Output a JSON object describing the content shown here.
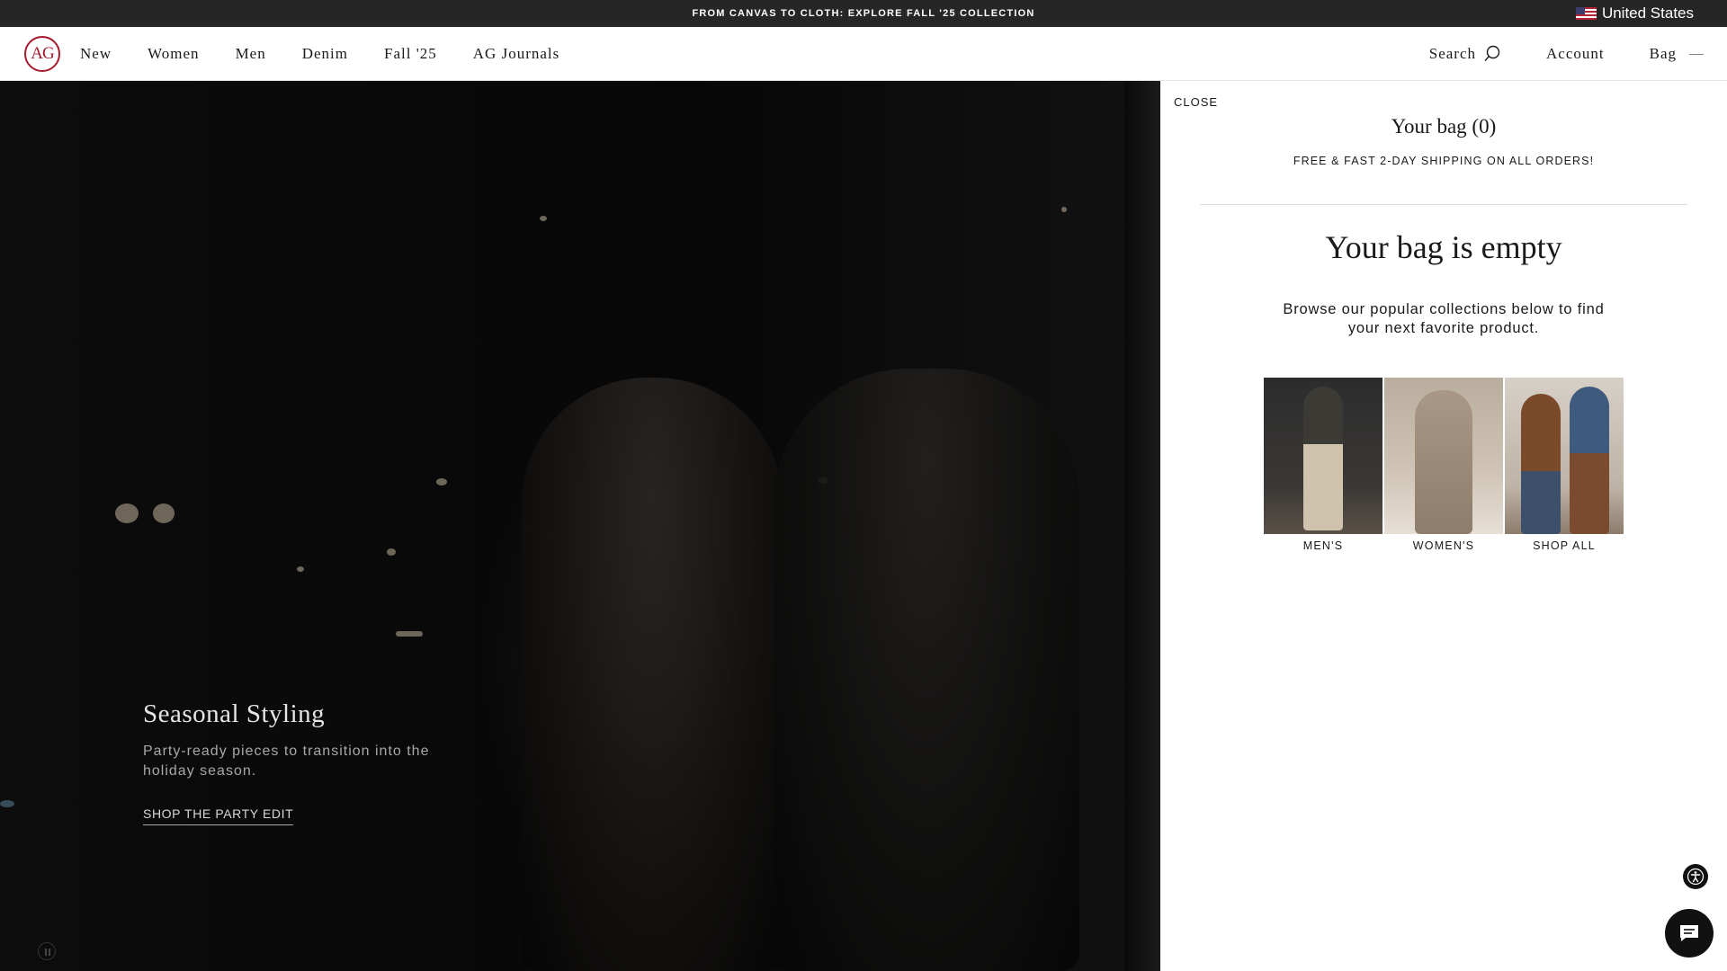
{
  "announcement": {
    "text": "FROM CANVAS TO CLOTH: EXPLORE FALL '25 COLLECTION",
    "region": "United States",
    "flag_icon": "us-flag-icon"
  },
  "header": {
    "logo_text": "AG",
    "brand_color": "#a6192e",
    "nav": [
      "New",
      "Women",
      "Men",
      "Denim",
      "Fall '25",
      "AG Journals"
    ],
    "search_label": "Search",
    "account_label": "Account",
    "bag_label": "Bag"
  },
  "hero": {
    "title": "Seasonal Styling",
    "subtitle": "Party-ready pieces to transition into the holiday season.",
    "cta": "SHOP THE PARTY EDIT"
  },
  "bag": {
    "close_label": "CLOSE",
    "title": "Your bag (0)",
    "shipping": "FREE & FAST 2-DAY SHIPPING ON ALL ORDERS!",
    "empty_title": "Your bag is empty",
    "empty_message": "Browse our popular collections below to find your next favorite product.",
    "collections": [
      "MEN'S",
      "WOMEN'S",
      "SHOP ALL"
    ]
  },
  "icons": {
    "search": "search-icon",
    "accessibility": "accessibility-icon",
    "chat": "chat-icon",
    "pause": "pause-icon"
  }
}
